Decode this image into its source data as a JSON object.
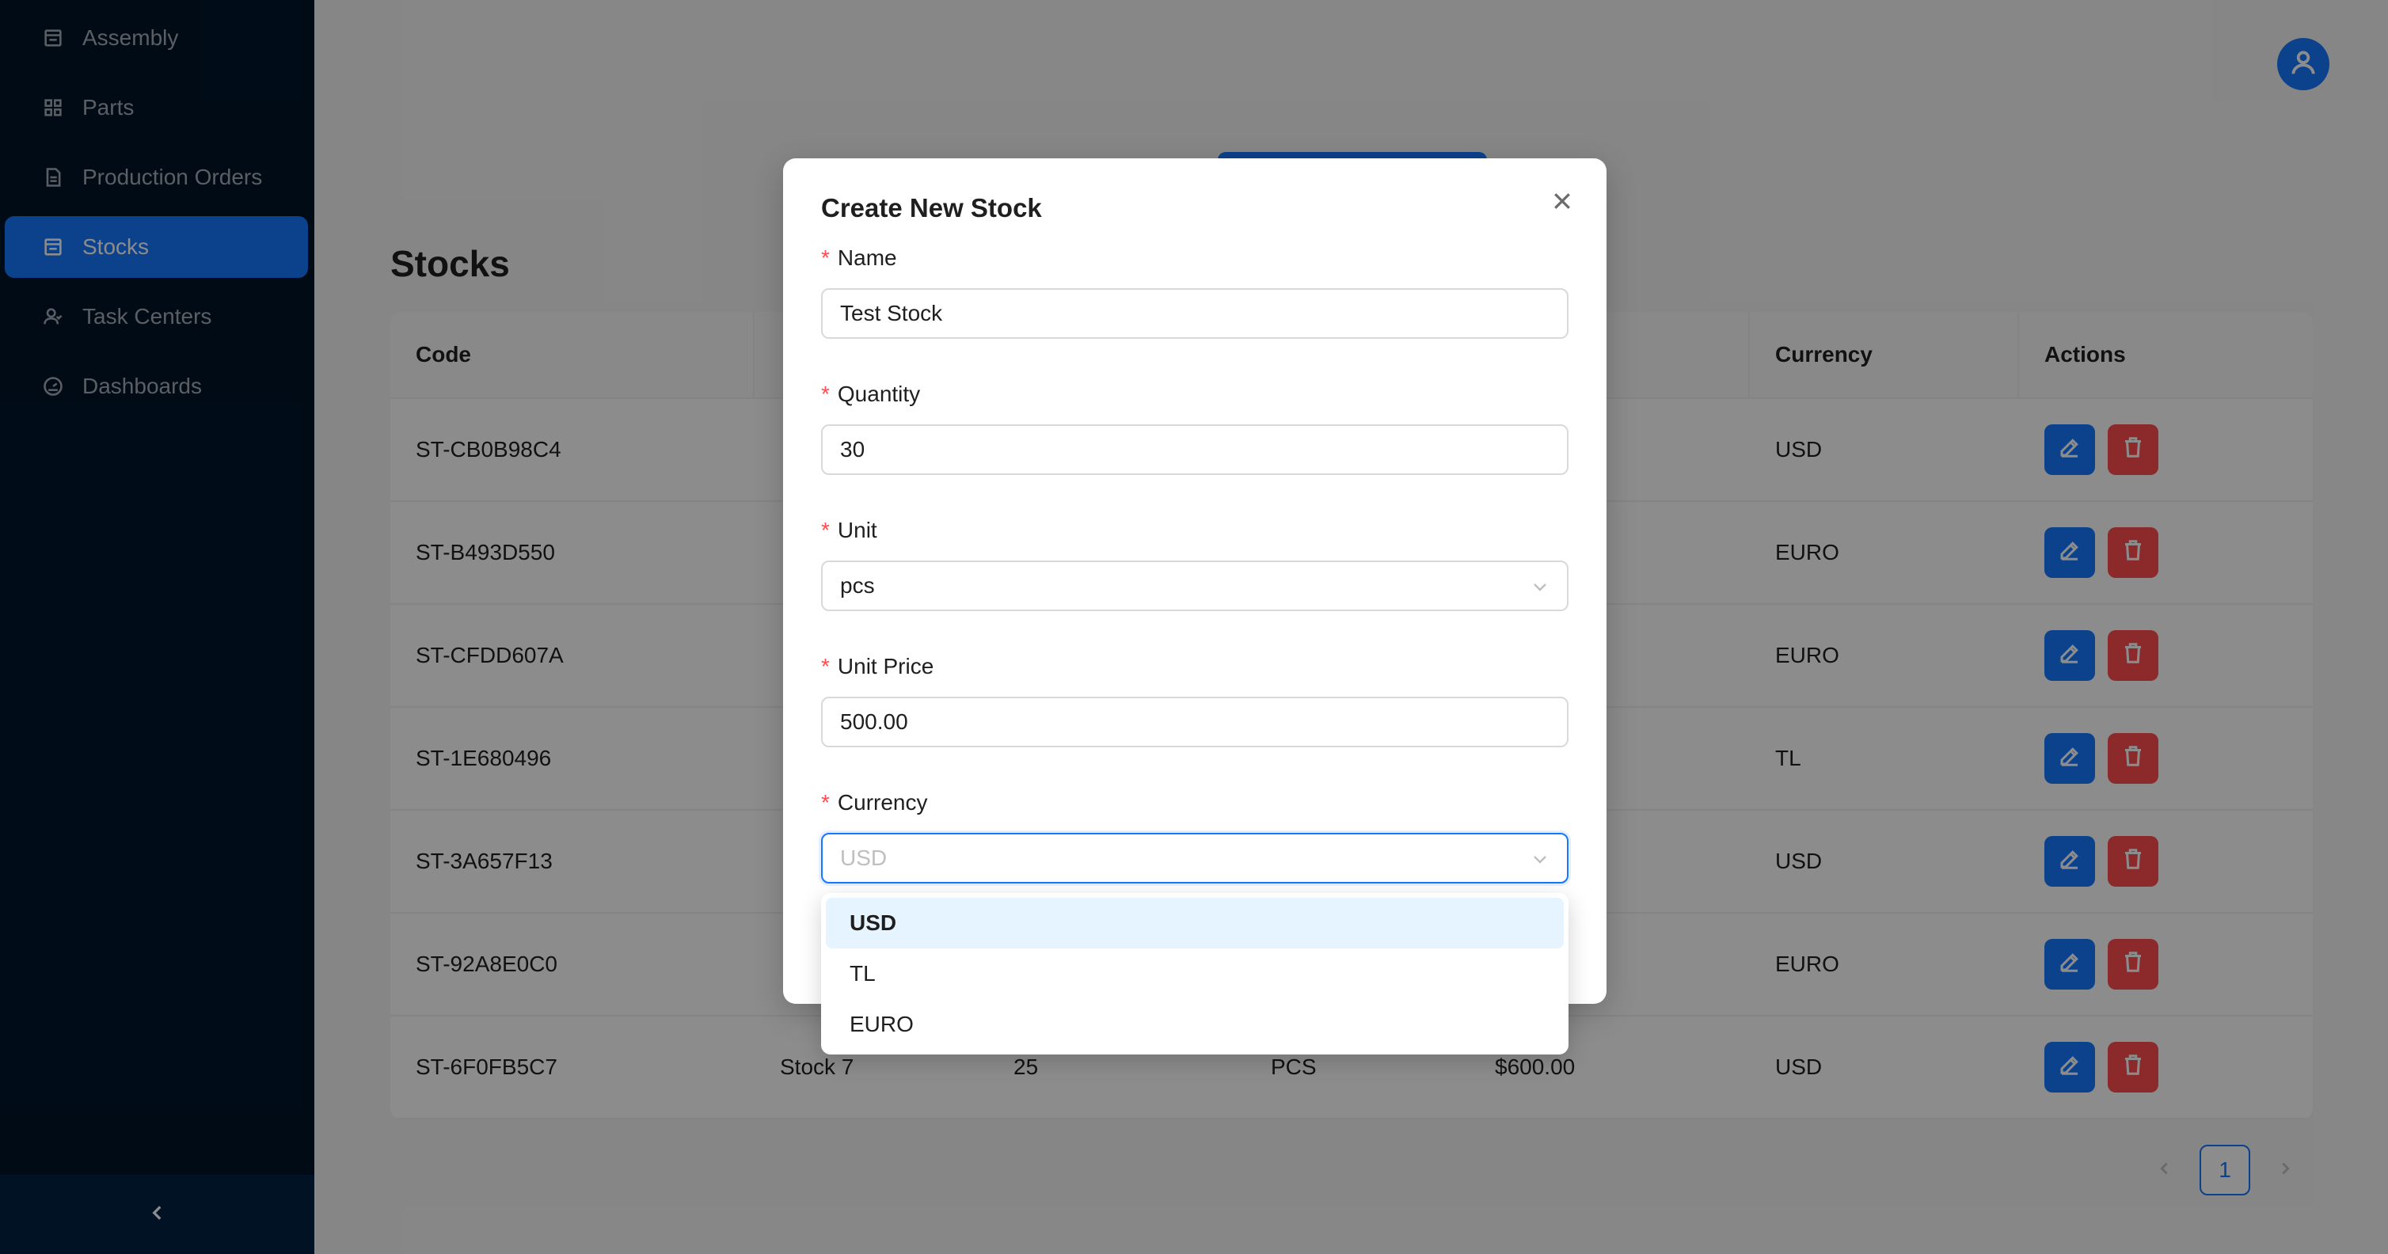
{
  "sidebar": {
    "items": [
      {
        "label": "Assembly",
        "icon": "shop-icon"
      },
      {
        "label": "Parts",
        "icon": "appstore-icon"
      },
      {
        "label": "Production Orders",
        "icon": "file-icon"
      },
      {
        "label": "Stocks",
        "icon": "shop-icon"
      },
      {
        "label": "Task Centers",
        "icon": "team-icon"
      },
      {
        "label": "Dashboards",
        "icon": "dashboard-icon"
      }
    ],
    "active_index": 3
  },
  "page": {
    "title": "Stocks"
  },
  "table": {
    "columns": [
      "Code",
      "",
      "",
      "",
      "",
      "Currency",
      "Actions"
    ],
    "rows": [
      {
        "code": "ST-CB0B98C4",
        "name": "",
        "quantity": "",
        "unit": "",
        "price": "",
        "currency": "USD"
      },
      {
        "code": "ST-B493D550",
        "name": "",
        "quantity": "",
        "unit": "",
        "price": "",
        "currency": "EURO"
      },
      {
        "code": "ST-CFDD607A",
        "name": "",
        "quantity": "",
        "unit": "",
        "price": "",
        "currency": "EURO"
      },
      {
        "code": "ST-1E680496",
        "name": "",
        "quantity": "",
        "unit": "",
        "price": "",
        "currency": "TL"
      },
      {
        "code": "ST-3A657F13",
        "name": "",
        "quantity": "",
        "unit": "",
        "price": "",
        "currency": "USD"
      },
      {
        "code": "ST-92A8E0C0",
        "name": "",
        "quantity": "",
        "unit": "",
        "price": "",
        "currency": "EURO"
      },
      {
        "code": "ST-6F0FB5C7",
        "name": "Stock 7",
        "quantity": "25",
        "unit": "PCS",
        "price": "$600.00",
        "currency": "USD"
      }
    ]
  },
  "pagination": {
    "current": "1"
  },
  "modal": {
    "title": "Create New Stock",
    "fields": {
      "name": {
        "label": "Name",
        "value": "Test Stock"
      },
      "quantity": {
        "label": "Quantity",
        "value": "30"
      },
      "unit": {
        "label": "Unit",
        "value": "pcs"
      },
      "unit_price": {
        "label": "Unit Price",
        "value": "500.00"
      },
      "currency": {
        "label": "Currency",
        "placeholder": "USD"
      }
    }
  },
  "dropdown": {
    "options": [
      "USD",
      "TL",
      "EURO"
    ],
    "highlighted_index": 0
  },
  "colors": {
    "sidebar_bg": "#001529",
    "primary": "#1677ff",
    "danger": "#ff4d4f"
  }
}
